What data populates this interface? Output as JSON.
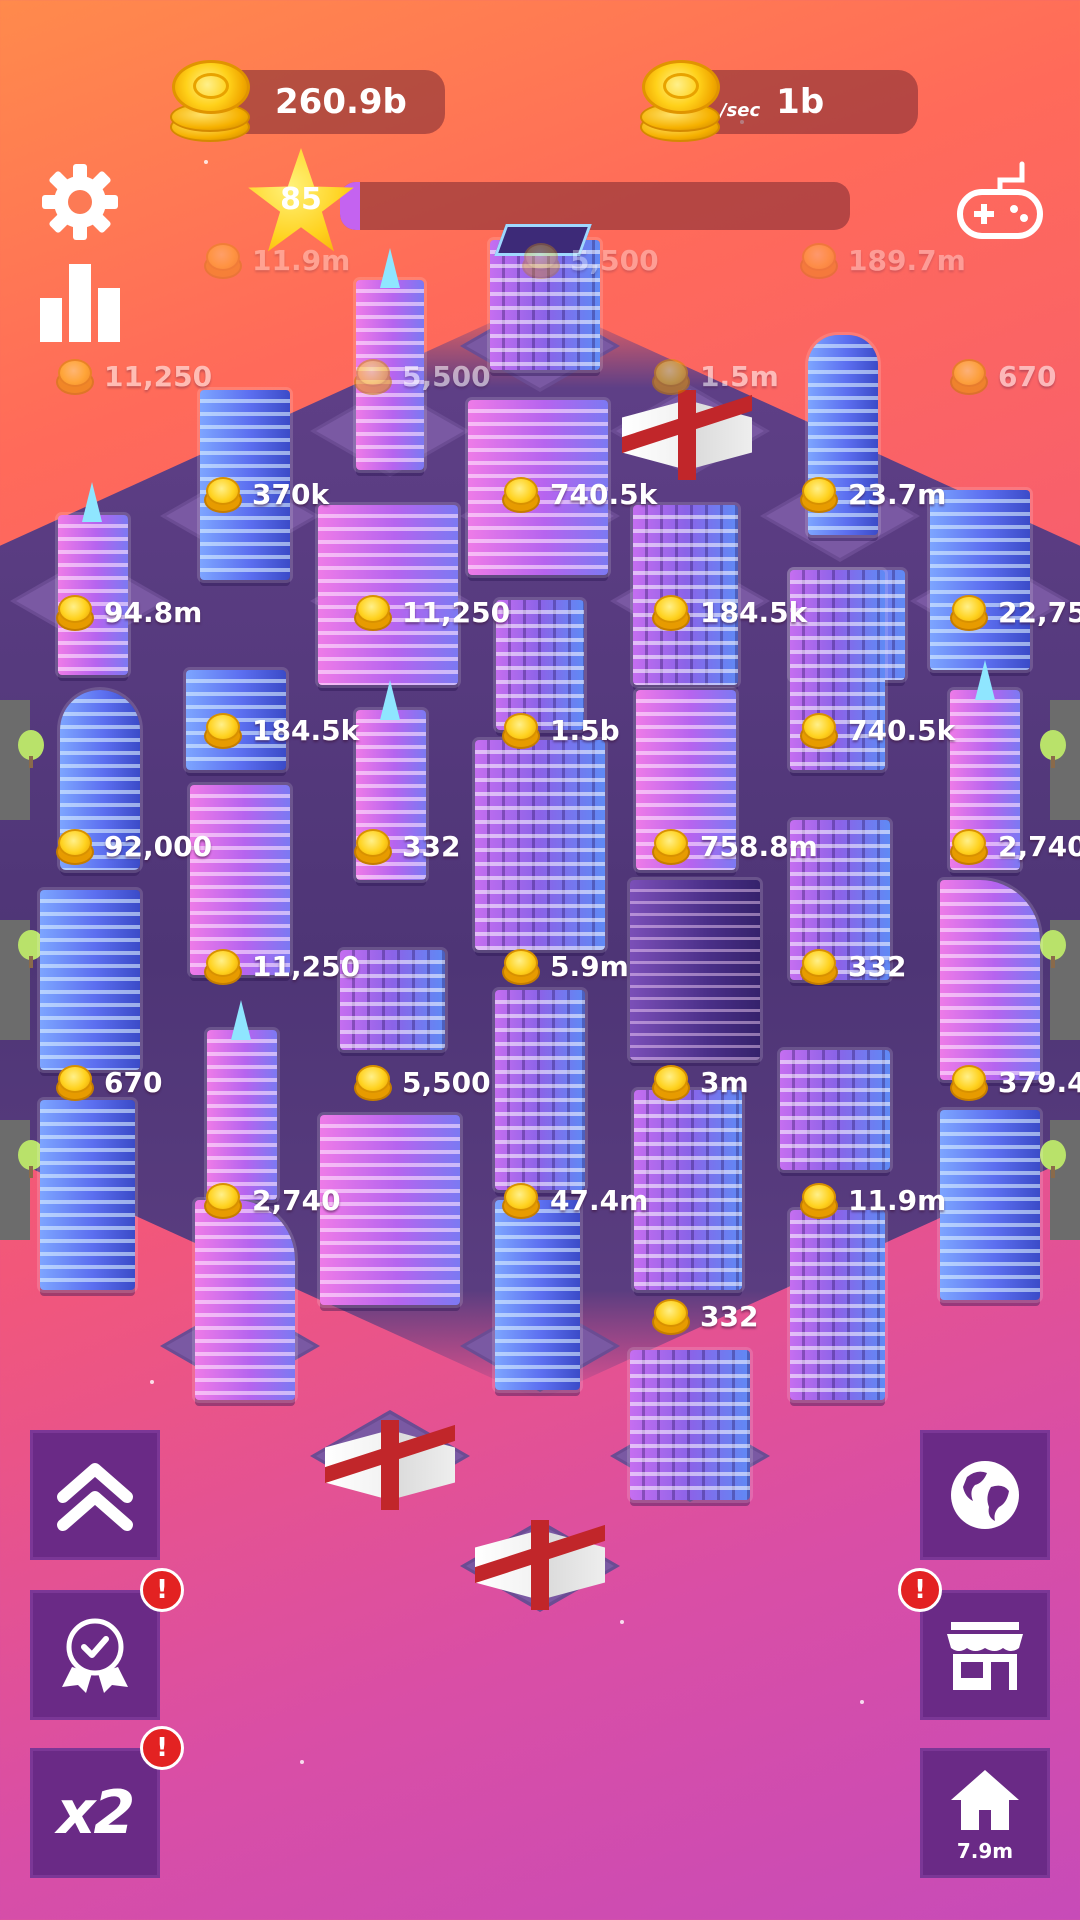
{
  "hud": {
    "coins_total": "260.9b",
    "income_unit": "/sec",
    "income_rate": "1b",
    "level": "85",
    "level_progress": 0.04
  },
  "building_labels": [
    "11.9m",
    "5,500",
    "189.7m",
    "11,250",
    "5,500",
    "1.5m",
    "670",
    "370k",
    "740.5k",
    "23.7m",
    "94.8m",
    "11,250",
    "184.5k",
    "22,75",
    "184.5k",
    "1.5b",
    "740.5k",
    "92,000",
    "332",
    "758.8m",
    "2,740",
    "11,250",
    "5.9m",
    "332",
    "670",
    "5,500",
    "3m",
    "379.4",
    "2,740",
    "47.4m",
    "11.9m",
    "332"
  ],
  "buttons": {
    "x2_label": "x2",
    "home_value": "7.9m",
    "alert_mark": "!"
  },
  "icons": {
    "settings": "gear-icon",
    "stats": "bar-chart-icon",
    "games": "gamepad-icon",
    "upgrade": "double-chevron-up-icon",
    "achievements": "award-badge-icon",
    "globe": "globe-icon",
    "shop": "shop-icon",
    "home": "home-icon"
  },
  "colors": {
    "button_bg": "#6a2a86",
    "pill_bg": "rgba(120,40,50,0.55)",
    "level_fill": "#c463f0",
    "alert": "#e32222"
  }
}
